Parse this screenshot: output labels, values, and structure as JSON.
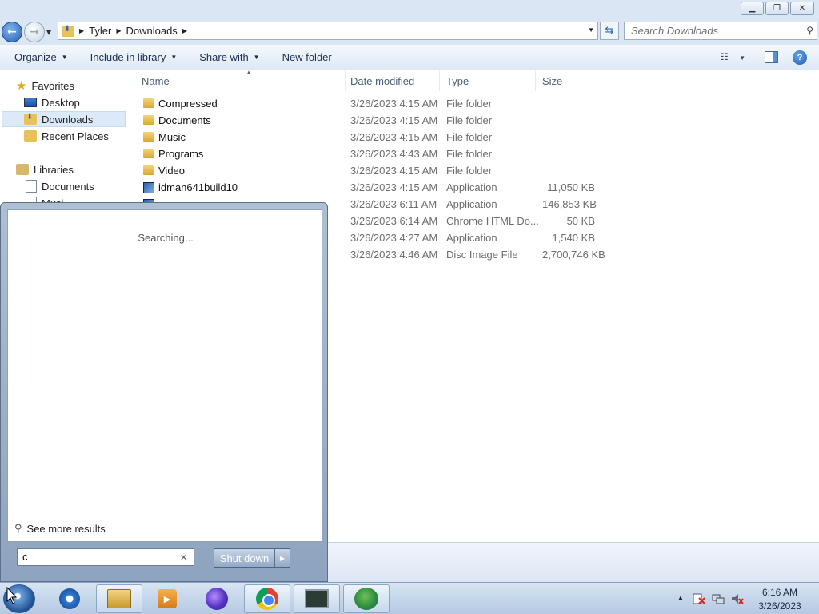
{
  "breadcrumb": [
    "Tyler",
    "Downloads"
  ],
  "search": {
    "placeholder": "Search Downloads"
  },
  "cmdbar": {
    "organize": "Organize",
    "include": "Include in library",
    "share": "Share with",
    "newfolder": "New folder"
  },
  "nav": {
    "favorites": "Favorites",
    "desktop": "Desktop",
    "downloads": "Downloads",
    "recent": "Recent Places",
    "libraries": "Libraries",
    "documents": "Documents",
    "music_partial": "Musi"
  },
  "columns": {
    "name": "Name",
    "date": "Date modified",
    "type": "Type",
    "size": "Size"
  },
  "files": [
    {
      "name": "Compressed",
      "date": "3/26/2023 4:15 AM",
      "type": "File folder",
      "size": "",
      "icon": "folder-icon"
    },
    {
      "name": "Documents",
      "date": "3/26/2023 4:15 AM",
      "type": "File folder",
      "size": "",
      "icon": "folder-icon"
    },
    {
      "name": "Music",
      "date": "3/26/2023 4:15 AM",
      "type": "File folder",
      "size": "",
      "icon": "folder-icon"
    },
    {
      "name": "Programs",
      "date": "3/26/2023 4:43 AM",
      "type": "File folder",
      "size": "",
      "icon": "folder-icon"
    },
    {
      "name": "Video",
      "date": "3/26/2023 4:15 AM",
      "type": "File folder",
      "size": "",
      "icon": "folder-icon"
    },
    {
      "name": "idman641build10",
      "date": "3/26/2023 4:15 AM",
      "type": "Application",
      "size": "11,050 KB",
      "icon": "app-icon"
    },
    {
      "name": "",
      "date": "3/26/2023 6:11 AM",
      "type": "Application",
      "size": "146,853 KB",
      "icon": "app-icon"
    },
    {
      "name": "",
      "date": "3/26/2023 6:14 AM",
      "type": "Chrome HTML Do...",
      "size": "50 KB",
      "icon": "chrome-doc-icon"
    },
    {
      "name": "",
      "date": "3/26/2023 4:27 AM",
      "type": "Application",
      "size": "1,540 KB",
      "icon": "app-icon"
    },
    {
      "name": "",
      "date": "3/26/2023 4:46 AM",
      "type": "Disc Image File",
      "size": "2,700,746 KB",
      "icon": "disc-icon"
    }
  ],
  "startmenu": {
    "status": "Searching...",
    "see_more": "See more results",
    "query": "c",
    "shutdown": "Shut down"
  },
  "taskbar": {
    "apps": [
      "internet-explorer",
      "windows-explorer",
      "media-player",
      "firefox",
      "chrome",
      "task-manager",
      "internet-download-manager"
    ]
  },
  "clock": {
    "time": "6:16 AM",
    "date": "3/26/2023"
  }
}
